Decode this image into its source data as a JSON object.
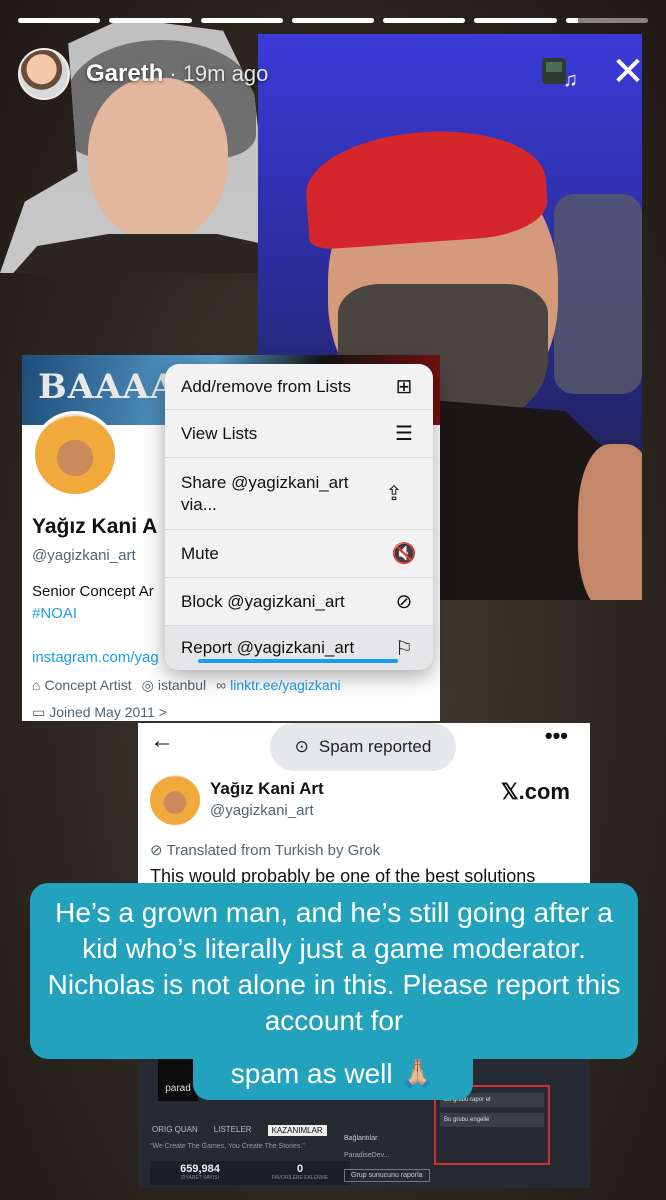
{
  "story": {
    "progress": [
      1,
      1,
      1,
      1,
      1,
      1,
      0.15
    ],
    "user": "Gareth",
    "separator": "·",
    "time": "19m ago",
    "close_icon": "✕",
    "music_icon": "♫"
  },
  "profile_card": {
    "banner_text": "BAAAAA",
    "name": "Yağız Kani A",
    "handle": "@yagizkani_art",
    "bio": "Senior Concept Ar",
    "hashtag": "#NOAI",
    "link": "instagram.com/yag",
    "meta_job": "Concept Artist",
    "meta_location": "istanbul",
    "meta_link": "linktr.ee/yagizkani",
    "joined": "Joined May 2011 >"
  },
  "menu": {
    "items": [
      {
        "label": "Add/remove from Lists",
        "icon": "list-add-icon"
      },
      {
        "label": "View Lists",
        "icon": "list-icon"
      },
      {
        "label": "Share @yagizkani_art via...",
        "icon": "share-icon"
      },
      {
        "label": "Mute",
        "icon": "mute-icon"
      },
      {
        "label": "Block @yagizkani_art",
        "icon": "block-icon"
      },
      {
        "label": "Report @yagizkani_art",
        "icon": "flag-icon"
      }
    ]
  },
  "toast": {
    "label": "Spam reported"
  },
  "tweet": {
    "back": "←",
    "more": "•••",
    "name": "Yağız Kani Art",
    "handle": "@yagizkani_art",
    "brand": "𝕏.com",
    "translated": "Translated from Turkish by Grok",
    "body": "This would probably be one of the best solutions",
    "shot": {
      "logo_text": "parad",
      "tabs": [
        "ORIG QUAN",
        "LISTELER",
        "KAZANIMLAR"
      ],
      "quote": "\"We Create The Games, You Create The Stories.\"",
      "stat1_value": "659,984",
      "stat1_label": "ZİYARET SAYISI",
      "stat2_value": "0",
      "stat2_label": "FAVORİLERE EKLENME",
      "right_title": "Bağlantılar",
      "right_sub": "ParadiseDev...",
      "right_button": "Grup sunucunu raporla",
      "redbox_opts": [
        "Bu grubu rapor et",
        "Bu grubu engelle"
      ]
    }
  },
  "caption": {
    "line1": "He’s a grown man, and he’s still going after a kid who’s literally just a game moderator. Nicholas is not alone in this. Please report this account for",
    "line2": "spam as well 🙏🏼"
  }
}
